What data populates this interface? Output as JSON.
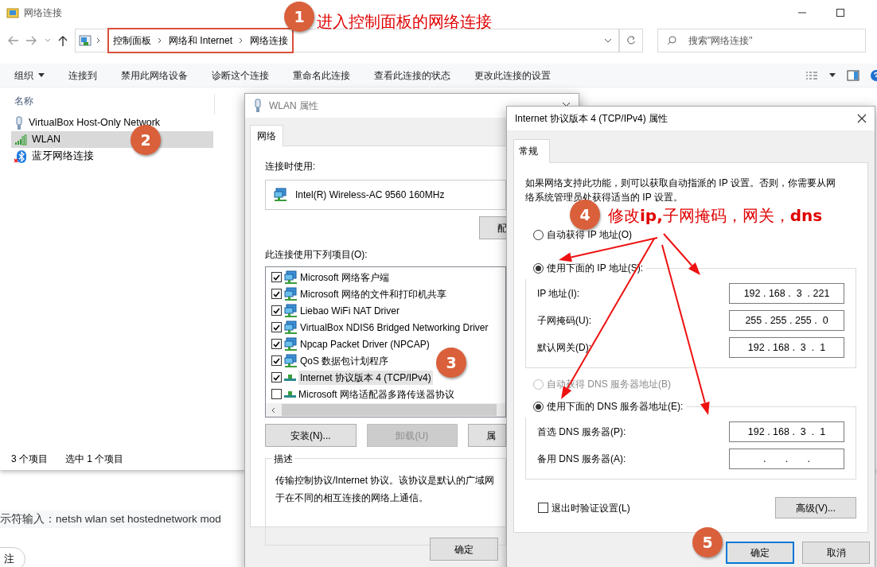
{
  "explorer": {
    "title": "网络连接",
    "breadcrumb": [
      "控制面板",
      "网络和 Internet",
      "网络连接"
    ],
    "search": {
      "placeholder": "搜索\"网络连接\""
    },
    "toolbar": [
      {
        "label": "组织",
        "dropdown": true
      },
      {
        "label": "连接到",
        "dropdown": false
      },
      {
        "label": "禁用此网络设备",
        "dropdown": false
      },
      {
        "label": "诊断这个连接",
        "dropdown": false
      },
      {
        "label": "重命名此连接",
        "dropdown": false
      },
      {
        "label": "查看此连接的状态",
        "dropdown": false
      },
      {
        "label": "更改此连接的设置",
        "dropdown": false
      }
    ],
    "column": "名称",
    "items": [
      {
        "name": "VirtualBox Host-Only Network",
        "kind": "adapter",
        "selected": false
      },
      {
        "name": "WLAN",
        "kind": "wifi",
        "selected": true
      },
      {
        "name": "蓝牙网络连接",
        "kind": "bluetooth",
        "selected": false
      }
    ],
    "status": [
      "3 个项目",
      "选中 1 个项目"
    ]
  },
  "background_page": {
    "command_line": "示符输入：netsh wlan set hostednetwork mod",
    "button": "注"
  },
  "wlan_dialog": {
    "title": "WLAN 属性",
    "tabs": [
      {
        "label": "网络",
        "selected": true
      }
    ],
    "connect_label": "连接时使用:",
    "adapter": "Intel(R) Wireless-AC 9560 160MHz",
    "configure_button": "配",
    "items_label": "此连接使用下列项目(O):",
    "components": [
      {
        "label": "Microsoft 网络客户端",
        "kind": "client",
        "checked": true,
        "selected": false
      },
      {
        "label": "Microsoft 网络的文件和打印机共享",
        "kind": "client",
        "checked": true,
        "selected": false
      },
      {
        "label": "Liebao WiFi NAT Driver",
        "kind": "client",
        "checked": true,
        "selected": false
      },
      {
        "label": "VirtualBox NDIS6 Bridged Networking Driver",
        "kind": "client",
        "checked": true,
        "selected": false
      },
      {
        "label": "Npcap Packet Driver (NPCAP)",
        "kind": "client",
        "checked": true,
        "selected": false
      },
      {
        "label": "QoS 数据包计划程序",
        "kind": "client",
        "checked": true,
        "selected": false
      },
      {
        "label": "Internet 协议版本 4 (TCP/IPv4)",
        "kind": "protocol",
        "checked": true,
        "selected": true
      },
      {
        "label": "Microsoft 网络适配器多路传送器协议",
        "kind": "protocol",
        "checked": false,
        "selected": false
      }
    ],
    "buttons": [
      {
        "label": "安装(N)...",
        "disabled": false
      },
      {
        "label": "卸载(U)",
        "disabled": true
      },
      {
        "label": "属",
        "disabled": false
      }
    ],
    "description_title": "描述",
    "description": "传输控制协议/Internet 协议。该协议是默认的广域网",
    "description_2": "于在不同的相互连接的网络上通信。",
    "ok_button": "确定"
  },
  "ipv4_dialog": {
    "title": "Internet 协议版本 4 (TCP/IPv4) 属性",
    "tabs": [
      {
        "label": "常规",
        "selected": true
      }
    ],
    "intro": "如果网络支持此功能，则可以获取自动指派的 IP 设置。否则，你需要从网络系统管理员处获得适当的 IP 设置。",
    "ip_modes": [
      {
        "label": "自动获得 IP 地址(O)",
        "selected": false,
        "disabled": false
      },
      {
        "label": "使用下面的 IP 地址(S):",
        "selected": true,
        "disabled": false
      }
    ],
    "ip_fields": [
      {
        "label": "IP 地址(I):",
        "value": "192 . 168 .  3  . 221"
      },
      {
        "label": "子网掩码(U):",
        "value": "255 . 255 . 255 .  0"
      },
      {
        "label": "默认网关(D):",
        "value": "192 . 168 .  3  .  1"
      }
    ],
    "dns_modes": [
      {
        "label": "自动获得 DNS 服务器地址(B)",
        "selected": false,
        "disabled": true
      },
      {
        "label": "使用下面的 DNS 服务器地址(E):",
        "selected": true,
        "disabled": false
      }
    ],
    "dns_fields": [
      {
        "label": "首选 DNS 服务器(P):",
        "value": "192 . 168 .  3  .  1"
      },
      {
        "label": "备用 DNS 服务器(A):",
        "value": ".       .       ."
      }
    ],
    "validate": {
      "label": "退出时验证设置(L)",
      "checked": false
    },
    "advanced_button": "高级(V)...",
    "ok_button": "确定",
    "cancel_button": "取消"
  },
  "annotations": {
    "steps": [
      "1",
      "2",
      "3",
      "4",
      "5"
    ],
    "notes": [
      "进入控制面板的网络连接",
      "修改**ip,**子网掩码，网关，**dns**"
    ]
  }
}
